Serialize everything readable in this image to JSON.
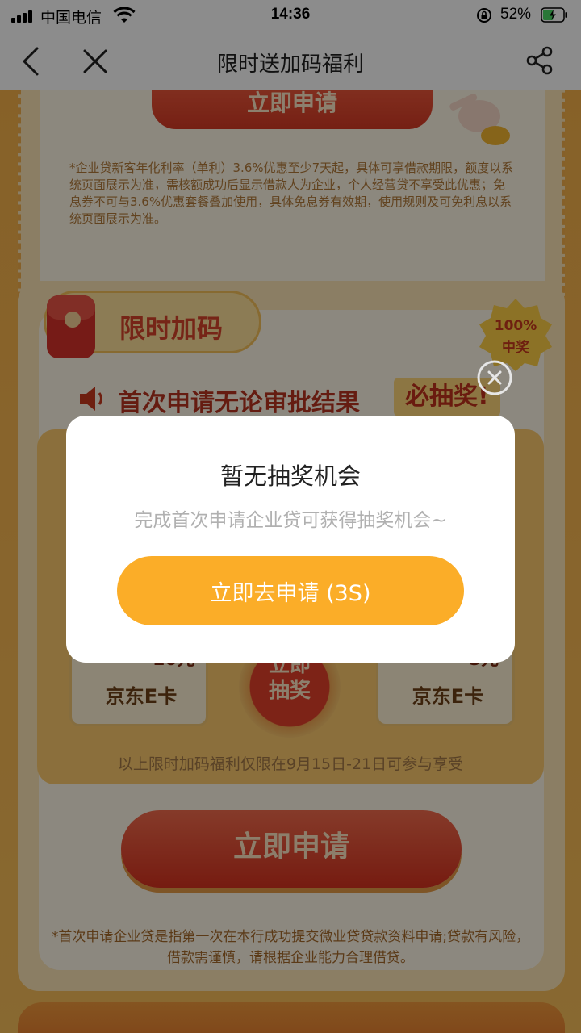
{
  "status_bar": {
    "carrier": "中国电信",
    "time": "14:36",
    "battery": "52%",
    "battery_level": 0.52
  },
  "nav": {
    "title": "限时送加码福利",
    "back_icon": "chevron-left-icon",
    "close_icon": "close-icon",
    "share_icon": "share-icon"
  },
  "page": {
    "top_button_label": "立即申请",
    "top_disclaimer": "*企业贷新客年化利率（单利）3.6%优惠至少7天起，具体可享借款期限，额度以系统页面展示为准，需核额成功后显示借款人为企业，个人经营贷不享受此优惠；免息券不可与3.6%优惠套餐叠加使用，具体免息券有效期，使用规则及可免利息以系统页面展示为准。",
    "promo_tag": "限时加码",
    "badge_line1": "100%",
    "badge_line2": "中奖",
    "headline": "首次申请无论审批结果",
    "headline_highlight": "必抽奖!",
    "prizes": [
      {
        "value": "10元",
        "name": "京东E卡"
      },
      {
        "value": "5元",
        "name": "京东E卡"
      }
    ],
    "draw_button_line1": "立即",
    "draw_button_line2": "抽奖",
    "period_note": "以上限时加码福利仅限在9月15日-21日可参与享受",
    "apply_button_label": "立即申请",
    "bottom_disclaimer": "*首次申请企业贷是指第一次在本行成功提交微业贷贷款资料申请;贷款有风险，借款需谨慎，请根据企业能力合理借贷。"
  },
  "dialog": {
    "title": "暂无抽奖机会",
    "message": "完成首次申请企业贷可获得抽奖机会~",
    "button_label": "立即去申请 (3S)",
    "close_icon": "close-circle-icon",
    "accent_color": "#fbad28"
  }
}
